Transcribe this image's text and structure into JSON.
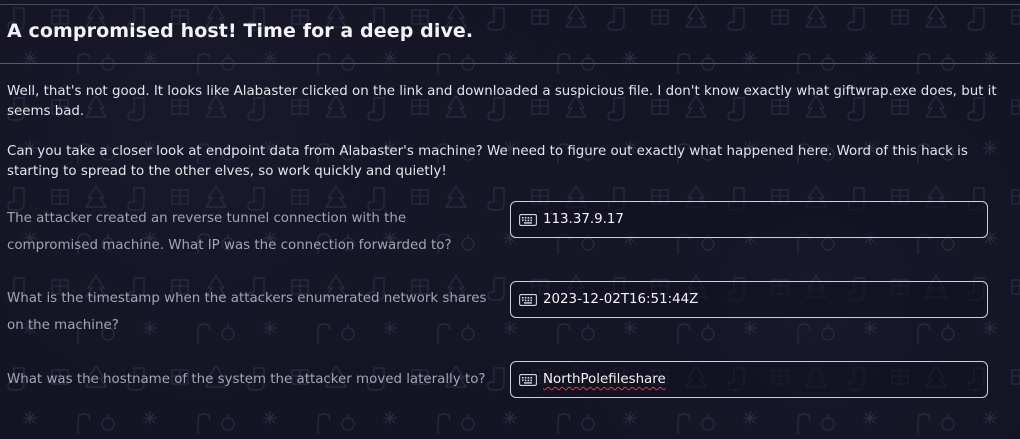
{
  "section": {
    "title": "A compromised host! Time for a deep dive."
  },
  "intro": {
    "paragraph_1": "Well, that's not good. It looks like Alabaster clicked on the link and downloaded a suspicious file. I don't know exactly what giftwrap.exe does, but it seems bad.",
    "paragraph_2": "Can you take a closer look at endpoint data from Alabaster's machine? We need to figure out exactly what happened here. Word of this hack is starting to spread to the other elves, so work quickly and quietly!"
  },
  "questions": [
    {
      "label": "The attacker created an reverse tunnel connection with the compromised machine. What IP was the connection forwarded to?",
      "answer": "113.37.9.17",
      "icon": "keyboard-icon"
    },
    {
      "label": "What is the timestamp when the attackers enumerated network shares on the machine?",
      "answer": "2023-12-02T16:51:44Z",
      "icon": "keyboard-icon"
    },
    {
      "label": "What was the hostname of the system the attacker moved laterally to?",
      "answer": "NorthPolefileshare",
      "icon": "keyboard-icon"
    }
  ],
  "colors": {
    "background": "#11111f",
    "text_primary": "#e4e4ec",
    "text_muted": "#a4a4b4",
    "input_border": "#cfcfd8",
    "spellcheck_underline": "#e03a3a"
  }
}
